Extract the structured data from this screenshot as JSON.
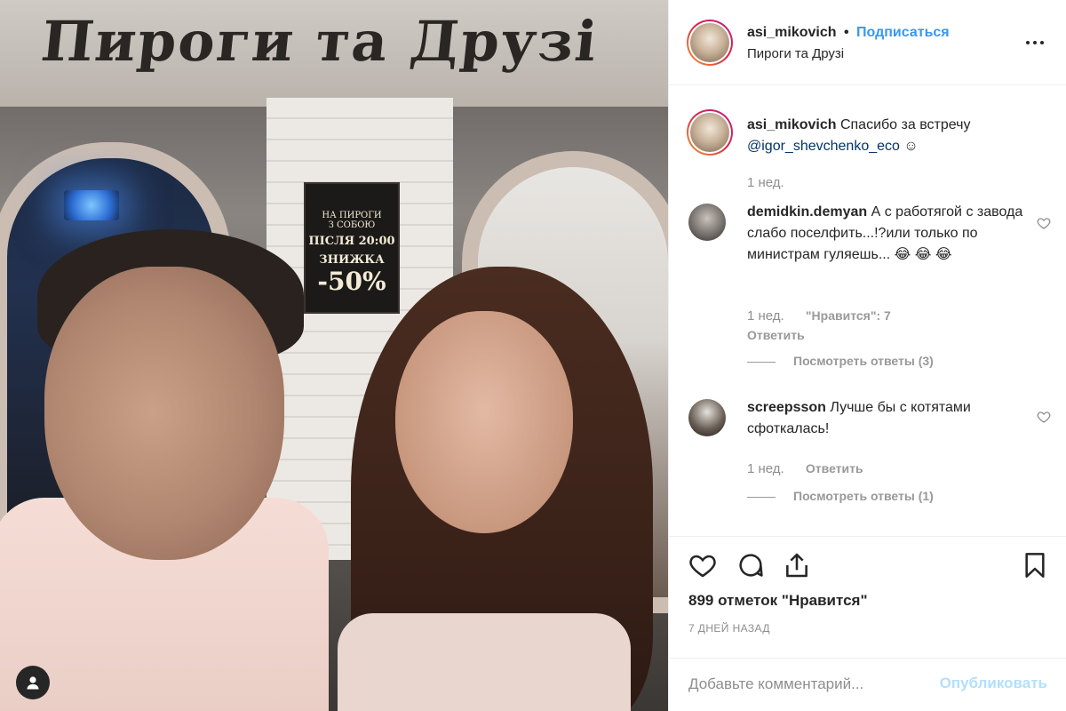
{
  "photo": {
    "sign_text": "Пироги та Друзі",
    "poster": {
      "line1": "НА ПИРОГИ",
      "line2": "З СОБОЮ",
      "line3": "ПІСЛЯ 20:00",
      "line4": "ЗНИЖКА",
      "line5": "-50%"
    },
    "user_tag_icon": "person-icon"
  },
  "header": {
    "username": "asi_mikovich",
    "separator": "•",
    "follow_label": "Подписаться",
    "location": "Пироги та Друзі",
    "more_icon": "ellipsis-icon"
  },
  "caption": {
    "username": "asi_mikovich",
    "text": "Спасибо за встречу",
    "mention": "@igor_shevchenko_eco",
    "emoji": "☺",
    "age": "1 нед."
  },
  "comments": [
    {
      "username": "demidkin.demyan",
      "text": "А с работягой с завода слабо поселфить...!?или только по министрам гуляешь... 😂 😂 😂",
      "age": "1 нед.",
      "likes_label": "\"Нравится\": 7",
      "reply_label": "Ответить",
      "view_replies": "Посмотреть ответы (3)"
    },
    {
      "username": "screepsson",
      "text": "Лучше бы с котятами сфоткалась!",
      "age": "1 нед.",
      "reply_label": "Ответить",
      "view_replies": "Посмотреть ответы (1)"
    }
  ],
  "actions": {
    "like_icon": "heart-icon",
    "comment_icon": "comment-icon",
    "share_icon": "share-icon",
    "save_icon": "bookmark-icon",
    "likes_count": "899 отметок \"Нравится\"",
    "time_ago": "7 ДНЕЙ НАЗАД"
  },
  "comment_box": {
    "placeholder": "Добавьте комментарий...",
    "publish_label": "Опубликовать",
    "publish_color": "#b2dffc"
  },
  "colors": {
    "link_blue": "#3897f0",
    "mention_blue": "#003569",
    "text": "#262626",
    "secondary": "#8e8e8e"
  }
}
